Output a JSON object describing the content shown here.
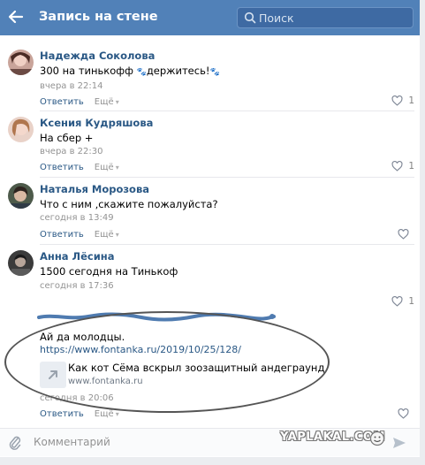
{
  "header": {
    "title": "Запись на стене",
    "search_placeholder": "Поиск"
  },
  "actions": {
    "reply_label": "Ответить",
    "more_label": "Ещё"
  },
  "comments": [
    {
      "author": "Надежда Соколова",
      "text_before": "300 на тинькофф ",
      "text_middle": "держитесь!",
      "date": "вчера в 22:14",
      "likes": "1"
    },
    {
      "author": "Ксения Кудряшова",
      "text": "На сбер +",
      "date": "вчера в 22:30",
      "likes": "1"
    },
    {
      "author": "Наталья Морозова",
      "text": "Что с ним ,скажите пожалуйста?",
      "date": "сегодня в 13:49",
      "likes": ""
    },
    {
      "author": "Анна Лёсина",
      "text": "1500 сегодня на Тинькоф",
      "date": "сегодня в 17:36",
      "likes": "1"
    },
    {
      "author": "",
      "text": "Ай да молодцы.",
      "link": "https://www.fontanka.ru/2019/10/25/128/",
      "share_title": "Как кот Сёма вскрыл зоозащитный андеграунд",
      "share_domain": "www.fontanka.ru",
      "date": "сегодня в 20:06",
      "likes": ""
    }
  ],
  "composer": {
    "placeholder": "Комментарий"
  },
  "watermark": "YAPLAKAL.COM",
  "colors": {
    "header": "#5181b8",
    "link": "#2a5885",
    "muted": "#939393",
    "divider": "#e7e8ec"
  }
}
